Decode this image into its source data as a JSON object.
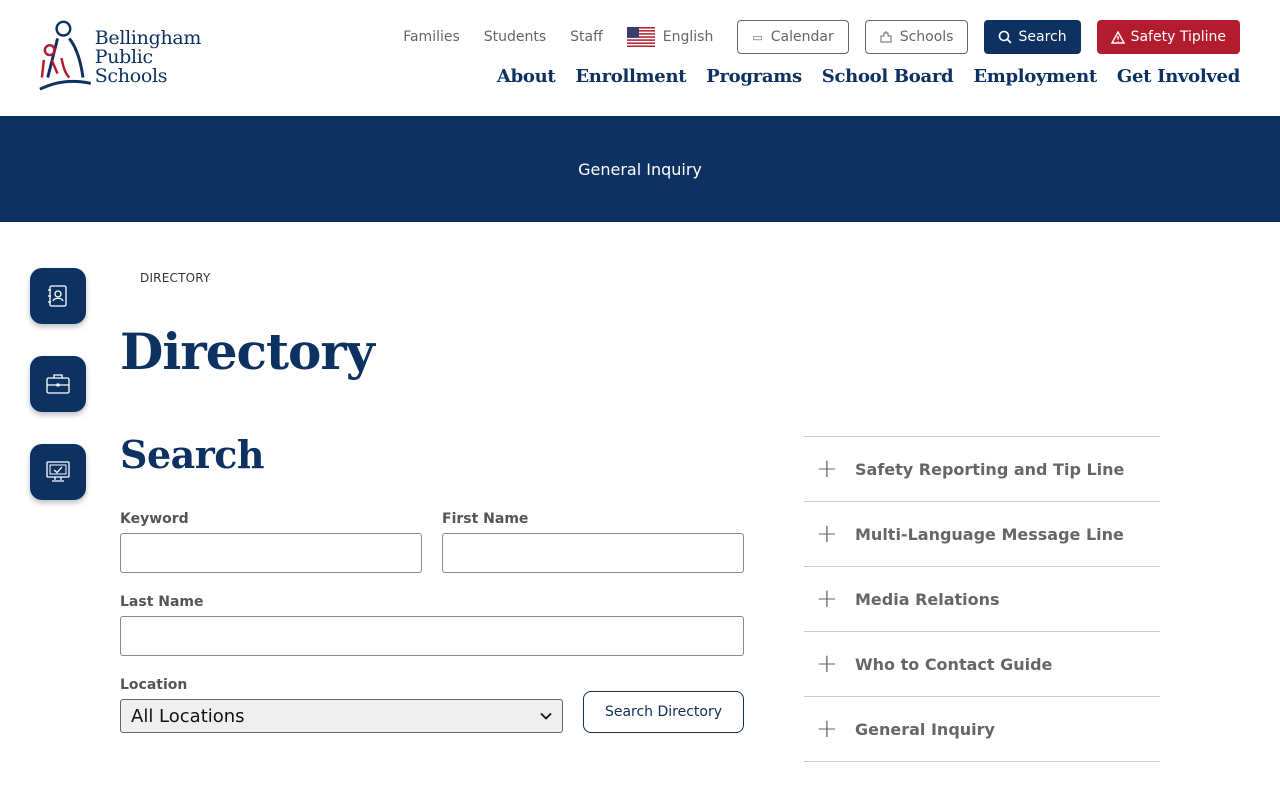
{
  "logo": {
    "line1": "Bellingham",
    "line2": "Public Schools"
  },
  "utility_nav": {
    "links": [
      "Families",
      "Students",
      "Staff"
    ],
    "language": "English",
    "calendar_label": "Calendar",
    "schools_label": "Schools",
    "search_label": "Search",
    "tipline_label": "Safety Tipline"
  },
  "main_nav": [
    "About",
    "Enrollment",
    "Programs",
    "School Board",
    "Employment",
    "Get Involved"
  ],
  "banner": {
    "text": "General Inquiry"
  },
  "side_links": [
    "directory-icon",
    "briefcase-icon",
    "computer-icon"
  ],
  "breadcrumb": "DIRECTORY",
  "page_title": "Directory",
  "search": {
    "title": "Search",
    "keyword_label": "Keyword",
    "first_name_label": "First Name",
    "last_name_label": "Last Name",
    "location_label": "Location",
    "location_value": "All Locations",
    "submit_label": "Search Directory"
  },
  "accordion": [
    "Safety Reporting and Tip Line",
    "Multi-Language Message Line",
    "Media Relations",
    "Who to Contact Guide",
    "General Inquiry"
  ],
  "colors": {
    "navy": "#0d3160",
    "red": "#b31b2e",
    "gray_text": "#666666"
  }
}
